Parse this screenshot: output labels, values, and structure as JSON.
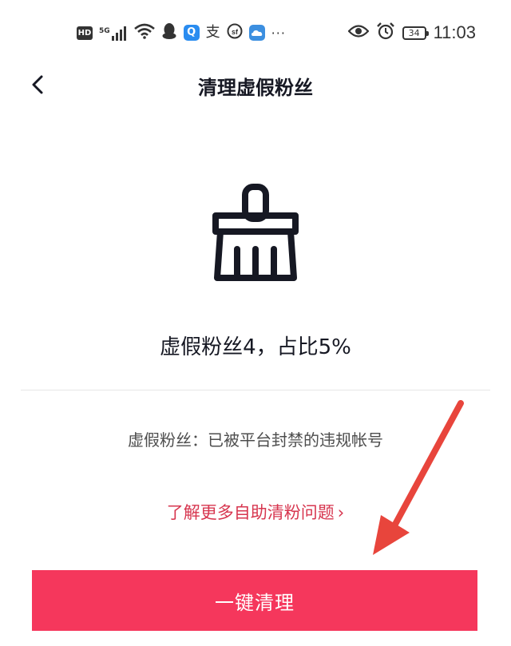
{
  "status_bar": {
    "hd_label": "HD",
    "network_label": "5G",
    "app_icons": [
      "wifi-icon",
      "qq-penguin-icon",
      "search-app-icon",
      "alipay-icon",
      "sf-express-icon",
      "weather-cloud-icon"
    ],
    "alipay_glyph": "支",
    "search_glyph": "Q",
    "more": "···",
    "battery_level": "34",
    "time": "11:03"
  },
  "nav": {
    "title": "清理虚假粉丝"
  },
  "content": {
    "stats": "虚假粉丝4，占比5%",
    "description": "虚假粉丝：已被平台封禁的违规帐号",
    "learn_more_label": "了解更多自助清粉问题",
    "learn_more_chevron": "›"
  },
  "action": {
    "primary_label": "一键清理"
  },
  "colors": {
    "primary": "#f5375c",
    "link": "#d7364f",
    "annotation_arrow": "#e8453c"
  }
}
